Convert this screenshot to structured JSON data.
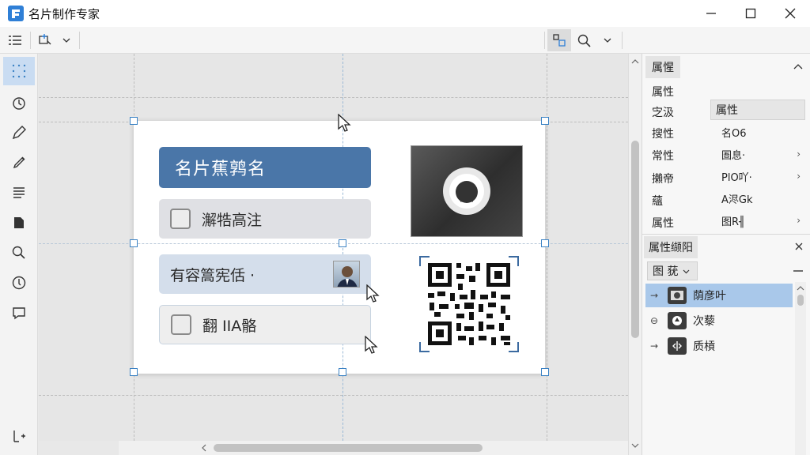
{
  "window": {
    "title": "名片制作专家"
  },
  "card": {
    "title_field": "名片蕉鹑名",
    "field2": "澥牿高注",
    "field3": "有容篙宪佸 ·",
    "field4": "翻  IIA骼"
  },
  "properties_panel": {
    "tab": "属惺",
    "section_label": "属性",
    "rows": [
      {
        "label": "㝎汲",
        "value": "属性"
      },
      {
        "label": "搜性",
        "value": "名O6"
      },
      {
        "label": "常性",
        "value": "圄息·"
      },
      {
        "label": "攋帝",
        "value": "PlO吖·"
      },
      {
        "label": "蘊",
        "value": "A浕Gk"
      },
      {
        "label": "属性",
        "value": "图R╢"
      }
    ]
  },
  "layers_panel": {
    "tab": "属性缬阳",
    "select_value": "图 莸",
    "items": [
      {
        "label": "荫彦叶",
        "selected": true
      },
      {
        "label": "次藜",
        "selected": false
      },
      {
        "label": "质槓",
        "selected": false
      }
    ]
  },
  "colors": {
    "accent": "#4a76a8",
    "selection": "#a9c8ea",
    "handle": "#3b82c4"
  }
}
